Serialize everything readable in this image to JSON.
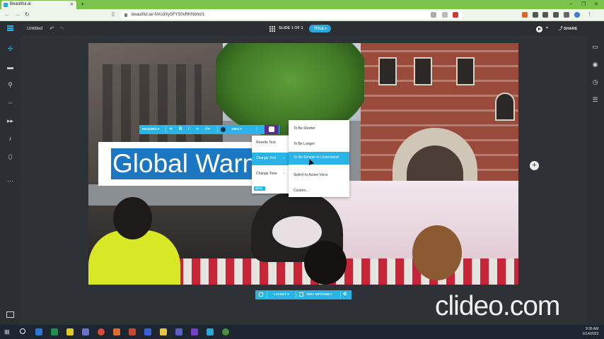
{
  "browser": {
    "tab_title": "Beautiful.ai",
    "url": "beautiful.ai/-NXs3Xy5FYS0vRKNbhn/1"
  },
  "app": {
    "document_title": "Untitled",
    "slide_counter": "SLIDE 1 OF 1",
    "theme_button": "TITLE ▾",
    "share_label": "SHARE",
    "accent_color": "#2ab3e6",
    "ai_color": "#5a2d91"
  },
  "text_toolbar": {
    "style_dropdown": "HEADING ▾",
    "zoom": "100% ▾"
  },
  "slide": {
    "title_text": "Global Warming"
  },
  "ai_menu": {
    "items": [
      {
        "label": "Rewrite Text",
        "has_submenu": false,
        "active": false
      },
      {
        "label": "Change Text",
        "has_submenu": true,
        "active": true
      },
      {
        "label": "Change Tone",
        "has_submenu": true,
        "active": false
      }
    ],
    "badge": "BETA"
  },
  "change_text_submenu": {
    "items": [
      {
        "label": "To Be Shorter"
      },
      {
        "label": "To Be Longer"
      },
      {
        "label": "To Be Simpler to Understand"
      },
      {
        "label": "Switch to Active Voice"
      },
      {
        "label": "Custom..."
      }
    ],
    "hovered_index": 2
  },
  "slide_toolbar": {
    "layout_label": "LAYOUT ▾",
    "text_options_label": "TEXT OPTIONS ▾"
  },
  "watermark": "clideo.com",
  "taskbar": {
    "time": "9:36 AM",
    "date": "6/14/2023"
  }
}
